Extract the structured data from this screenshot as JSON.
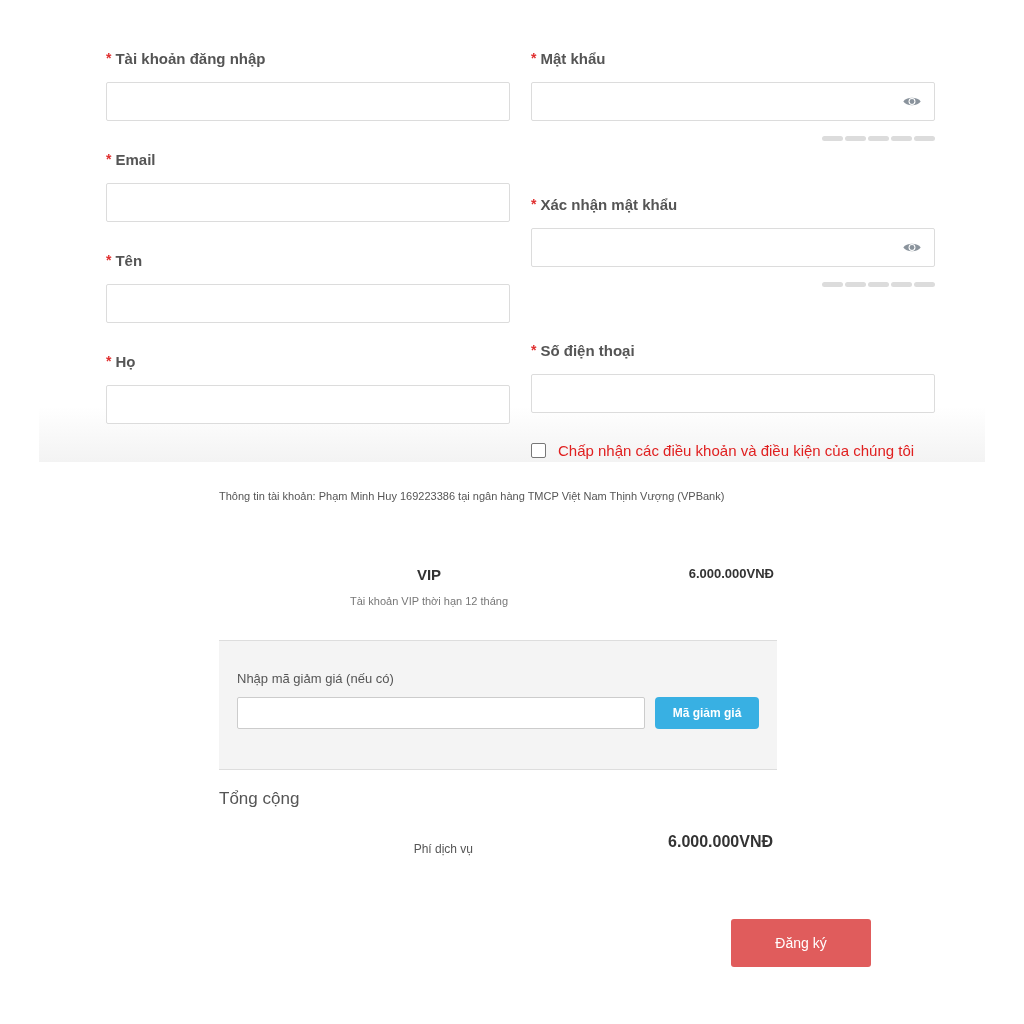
{
  "form": {
    "columns": [
      [
        {
          "kind": "text",
          "label": "Tài khoản đăng nhập",
          "required": true
        },
        {
          "kind": "text",
          "label": "Email",
          "required": true
        },
        {
          "kind": "text",
          "label": "Tên",
          "required": true
        },
        {
          "kind": "text",
          "label": "Họ",
          "required": true
        }
      ],
      [
        {
          "kind": "password",
          "label": "Mật khẩu",
          "required": true
        },
        {
          "kind": "password",
          "label": "Xác nhận mật khẩu",
          "required": true
        },
        {
          "kind": "text",
          "label": "Số điện thoại",
          "required": true
        }
      ]
    ],
    "required_mark": "*",
    "terms": {
      "label": "Chấp nhận các điều khoản và điều kiện của chúng tôi",
      "checked": false
    }
  },
  "account_info": "Thông tin tài khoản: Phạm Minh Huy 169223386 tại ngân hàng TMCP Việt Nam Thịnh Vượng (VPBank)",
  "package": {
    "name": "VIP",
    "description": "Tài khoản VIP thời hạn 12 tháng",
    "price": "6.000.000VNĐ"
  },
  "discount": {
    "label": "Nhập mã giảm giá (nếu có)",
    "button": "Mã giảm giá"
  },
  "total": {
    "title": "Tổng cộng",
    "item": "Phí dịch vụ",
    "amount": "6.000.000VNĐ"
  },
  "submit": "Đăng ký"
}
